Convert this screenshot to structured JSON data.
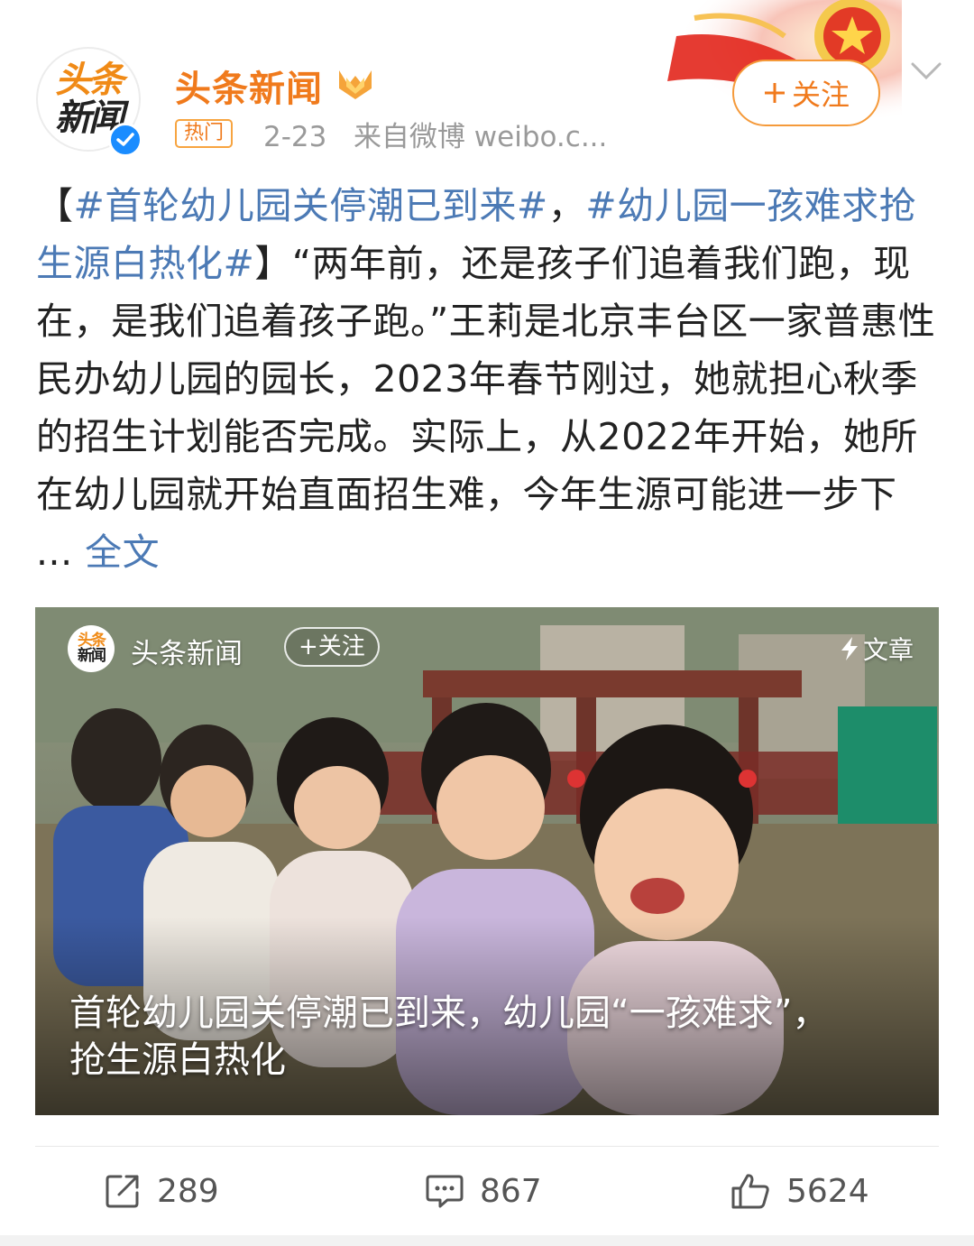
{
  "header": {
    "avatar_line1": "头条",
    "avatar_line2": "新闻",
    "username": "头条新闻",
    "badge": "热门",
    "date": "2-23",
    "source": "来自微博 weibo.c...",
    "follow_label": "关注"
  },
  "post": {
    "bracket_open": "【",
    "tag1": "#首轮幼儿园关停潮已到来#",
    "comma": "，",
    "tag2": "#幼儿园一孩难求抢生源白热化#",
    "bracket_close": "】",
    "body": "“两年前，还是孩子们追着我们跑，现在，是我们追着孩子跑。”王莉是北京丰台区一家普惠性民办幼儿园的园长，2023年春节刚过，她就担心秋季的招生计划能否完成。实际上，从2022年开始，她所在幼儿园就开始直面招生难，今年生源可能进一步下 ...",
    "more_label": "全文"
  },
  "media": {
    "avatar_line1": "头条",
    "avatar_line2": "新闻",
    "account_name": "头条新闻",
    "follow_label": "+关注",
    "type_label": "文章",
    "caption": "首轮幼儿园关停潮已到来，幼儿园“一孩难求”，抢生源白热化"
  },
  "actions": {
    "share_count": "289",
    "comment_count": "867",
    "like_count": "5624"
  },
  "colors": {
    "accent_orange": "#f07a1c",
    "link_blue": "#4c7ab5",
    "verified_blue": "#1a8cff"
  },
  "icons": [
    "verified-icon",
    "medal-icon",
    "chevron-down-icon",
    "flash-icon",
    "share-icon",
    "comment-icon",
    "like-icon"
  ]
}
